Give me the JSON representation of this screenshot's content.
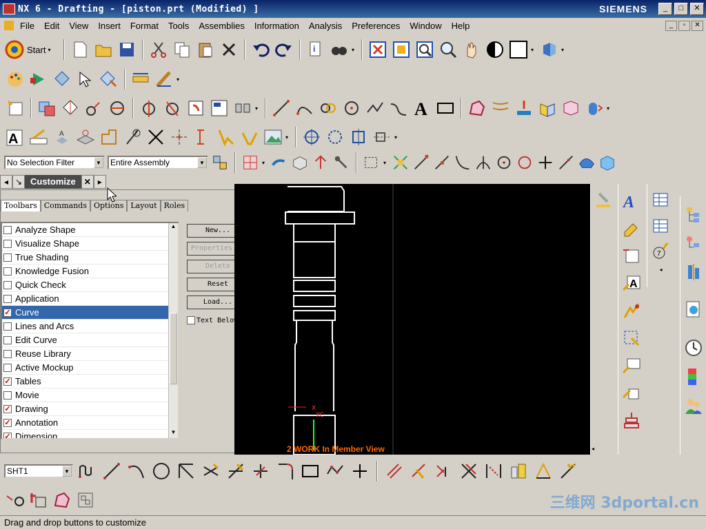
{
  "window": {
    "title": "NX 6 - Drafting - [piston.prt (Modified) ]",
    "brand": "SIEMENS",
    "minimize": "_",
    "maximize": "□",
    "close": "✕"
  },
  "menu": [
    "File",
    "Edit",
    "View",
    "Insert",
    "Format",
    "Tools",
    "Assemblies",
    "Information",
    "Analysis",
    "Preferences",
    "Window",
    "Help"
  ],
  "start_label": "Start",
  "selection": {
    "filter": "No Selection Filter",
    "scope": "Entire Assembly"
  },
  "navigator": {
    "tab_label": "Customize"
  },
  "customize": {
    "tabs": [
      "Toolbars",
      "Commands",
      "Options",
      "Layout",
      "Roles"
    ],
    "active_tab": "Toolbars",
    "toolbars": [
      {
        "label": "Analyze Shape",
        "checked": false,
        "selected": false
      },
      {
        "label": "Visualize Shape",
        "checked": false,
        "selected": false
      },
      {
        "label": "True Shading",
        "checked": false,
        "selected": false
      },
      {
        "label": "Knowledge Fusion",
        "checked": false,
        "selected": false
      },
      {
        "label": "Quick Check",
        "checked": false,
        "selected": false
      },
      {
        "label": "Application",
        "checked": false,
        "selected": false
      },
      {
        "label": "Curve",
        "checked": true,
        "selected": true
      },
      {
        "label": "Lines and Arcs",
        "checked": false,
        "selected": false
      },
      {
        "label": "Edit Curve",
        "checked": false,
        "selected": false
      },
      {
        "label": "Reuse Library",
        "checked": false,
        "selected": false
      },
      {
        "label": "Active Mockup",
        "checked": false,
        "selected": false
      },
      {
        "label": "Tables",
        "checked": true,
        "selected": false
      },
      {
        "label": "Movie",
        "checked": false,
        "selected": false
      },
      {
        "label": "Drawing",
        "checked": true,
        "selected": false
      },
      {
        "label": "Annotation",
        "checked": true,
        "selected": false
      },
      {
        "label": "Dimension",
        "checked": true,
        "selected": false
      }
    ],
    "buttons": {
      "new": "New...",
      "properties": "Properties...",
      "delete": "Delete",
      "reset": "Reset",
      "load": "Load..."
    },
    "text_below_icon": "Text Below Icon"
  },
  "canvas": {
    "view_label": "2 WORK In Member View",
    "xc_label": "XC"
  },
  "sheet": "SHT1",
  "status_text": "Drag and drop buttons to customize",
  "watermark": "三维网 3dportal.cn",
  "colors": {
    "selected_row": "#3366aa",
    "canvas_bg": "#000000",
    "view_label": "#ff6600"
  }
}
